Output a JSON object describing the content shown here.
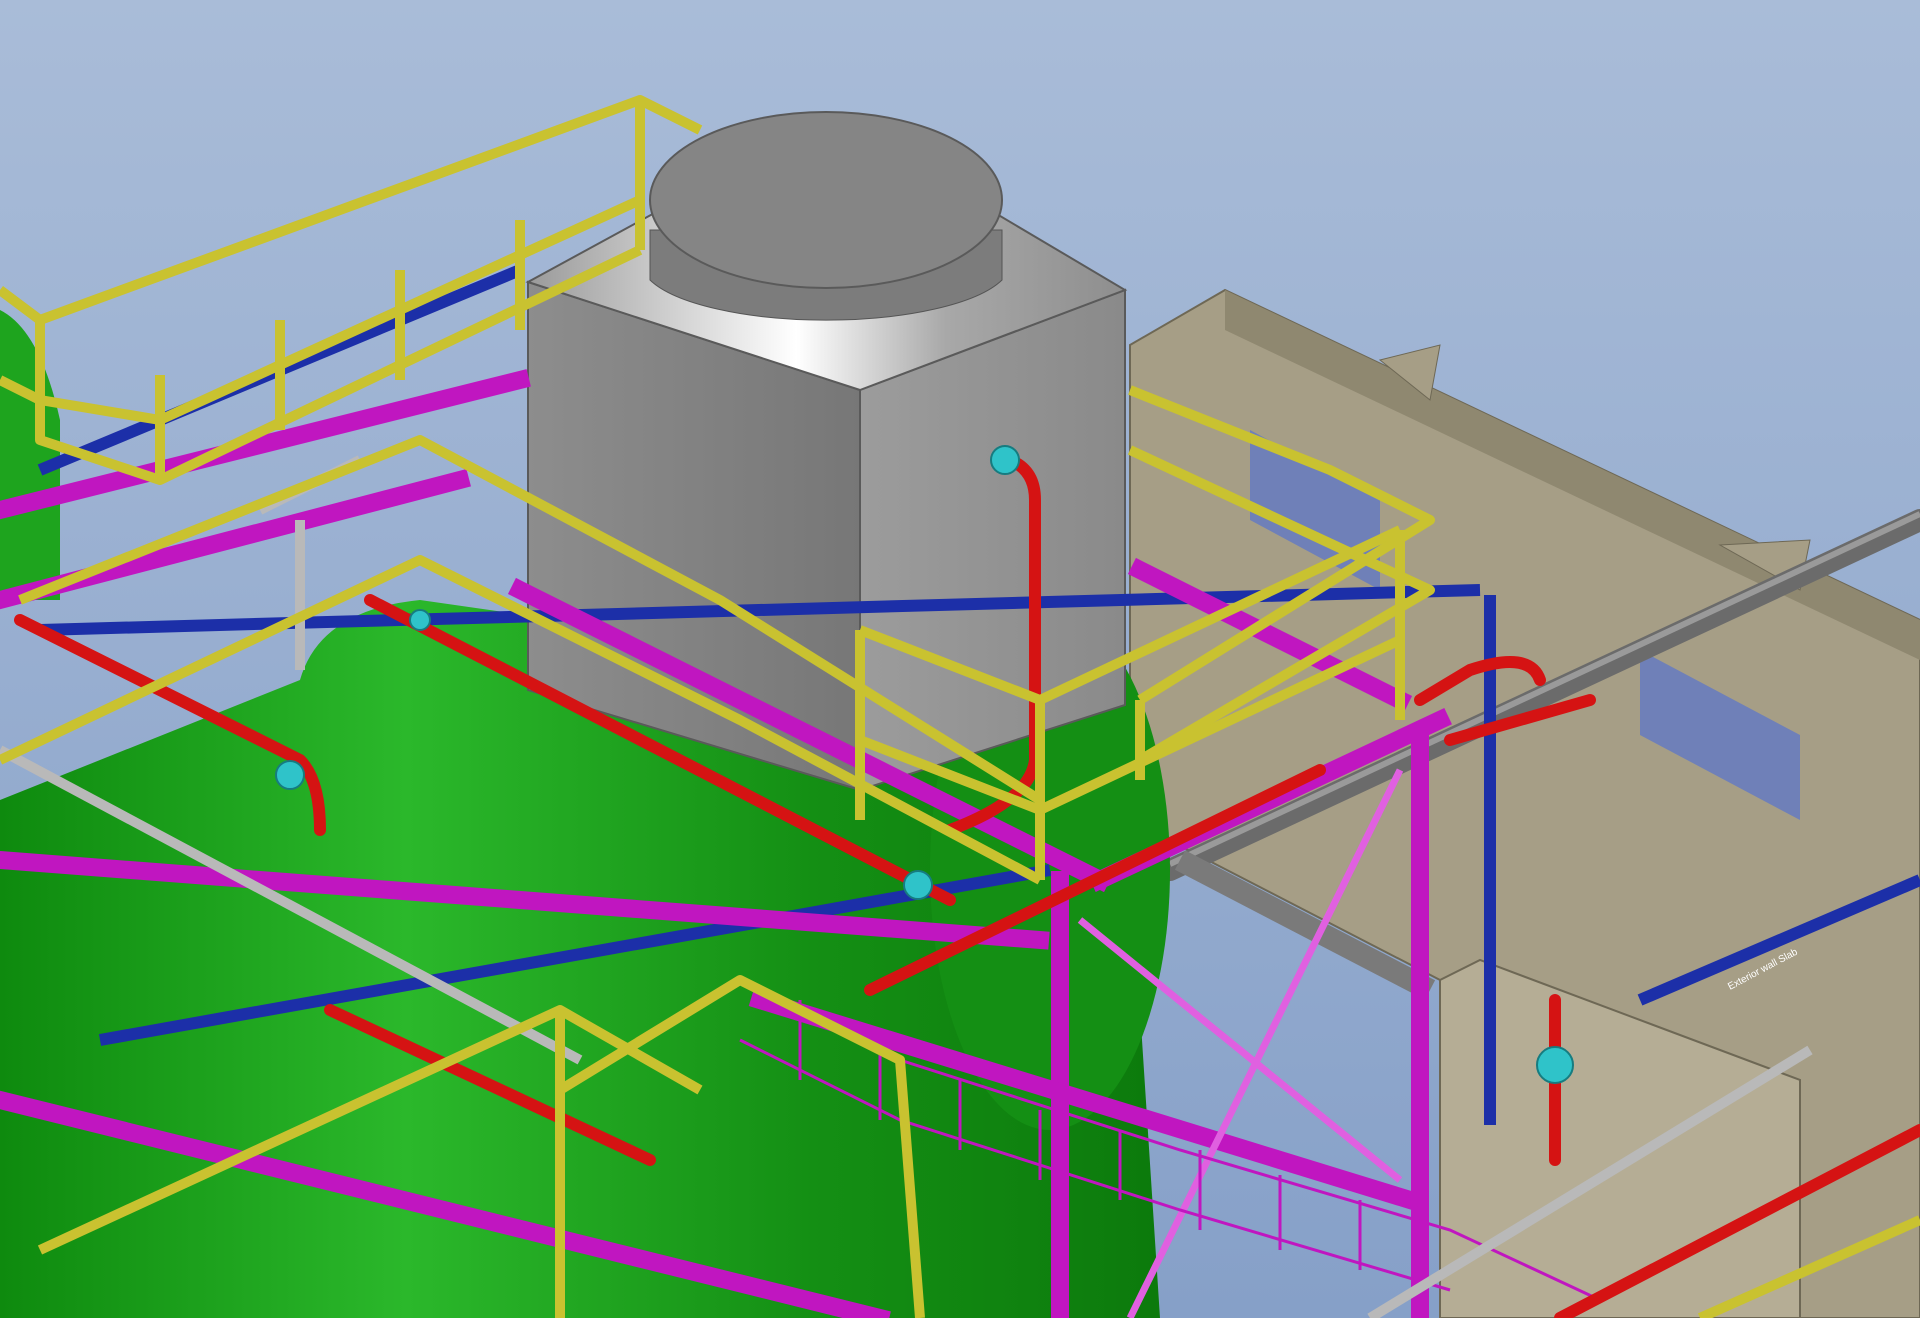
{
  "viewport": {
    "background_top": "#a7bad7",
    "background_bottom": "#8aa3c8",
    "wall_label": "Exterior wall Slab"
  },
  "palette": {
    "handrail_yellow": "#c9c230",
    "steel_magenta": "#c016c0",
    "pipe_red": "#d51313",
    "beam_blue": "#1c2fa8",
    "tank_green": "#19a319",
    "cooling_tower_grey": "#9a9a9a",
    "building_tan": "#a69e86",
    "valve_cyan": "#2fc3c9",
    "pipe_grey": "#b9b9b9"
  },
  "objects": [
    "cooling-tower",
    "fan-stack",
    "green-tank",
    "building-walls",
    "handrail-platform",
    "steel-frame",
    "red-pipes",
    "blue-beams",
    "grey-pipes",
    "stair-grating"
  ]
}
